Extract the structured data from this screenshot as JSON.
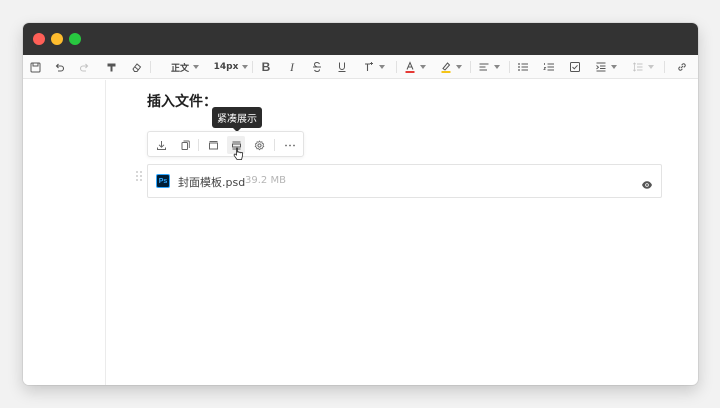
{
  "toolbar": {
    "paragraph_style": "正文",
    "font_size": "14px"
  },
  "editor": {
    "heading": "插入文件："
  },
  "tooltip": {
    "text": "紧凑展示"
  },
  "file": {
    "name": "封面模板.psd",
    "size": "39.2 MB",
    "icon_label": "Ps"
  },
  "colors": {
    "titlebar": "#333333",
    "traffic_red": "#fe5f57",
    "traffic_yellow": "#febc2e",
    "traffic_green": "#28c840",
    "font_color_swatch": "#e53935",
    "highlight_swatch": "#f5c518",
    "ps_brand": "#31a8ff"
  }
}
